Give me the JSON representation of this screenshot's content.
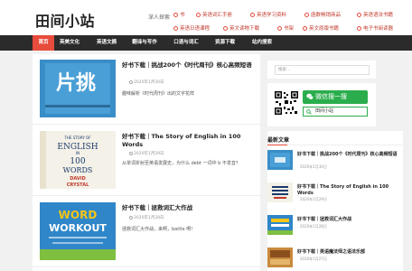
{
  "site": {
    "logo": "田间小站",
    "deep_explore": "深人探索"
  },
  "quicklinks": [
    {
      "label": "书"
    },
    {
      "label": "英语词汇手册"
    },
    {
      "label": "英语学习资料"
    },
    {
      "label": "函数畅销商品"
    },
    {
      "label": "英语语法书籍"
    },
    {
      "label": "英语日语课程"
    },
    {
      "label": "英文读物下载"
    },
    {
      "label": "书架"
    },
    {
      "label": "英文原版书籍"
    },
    {
      "label": "电子书阅读器"
    }
  ],
  "nav": {
    "items": [
      {
        "label": "首页",
        "active": true
      },
      {
        "label": "英美文化"
      },
      {
        "label": "英语文摘"
      },
      {
        "label": "翻译与写作"
      },
      {
        "label": "口语与词汇"
      },
      {
        "label": "资源下载"
      },
      {
        "label": "站内搜索"
      }
    ]
  },
  "articles": [
    {
      "title": "好书下载｜挑战200个《时代周刊》核心高频短语",
      "date": "2020年1月30日",
      "excerpt": "趣味解析《时代周刊》出的文字花样"
    },
    {
      "title": "好书下载｜The Story of English in 100 Words",
      "date": "2020年1月29日",
      "excerpt": "从单词折射至英语发展史，为什么 debt 一词中 b 不发音？"
    },
    {
      "title": "好书下载｜拯救词汇大作战",
      "date": "2020年1月28日",
      "excerpt": "拯救词汇大作战，来啊，battle 啊！"
    }
  ],
  "sidebar": {
    "search_placeholder": "搜索...",
    "wechat_button": "微信搜一搜",
    "wechat_query": "田间小站",
    "latest_heading": "最新文章",
    "latest": [
      {
        "title": "好书下载｜挑战200个《时代周刊》核心高频短语",
        "date": "2020年1月30日"
      },
      {
        "title": "好书下载｜The Story of English in 100 Words",
        "date": "2020年1月29日"
      },
      {
        "title": "好书下载｜拯救词汇大作战",
        "date": "2020年1月28日"
      },
      {
        "title": "好书下载｜英语魔法师之语法乐部",
        "date": "2020年1月27日"
      }
    ]
  },
  "thumb_text": {
    "book1_title": "片挑",
    "book2_lines": [
      "THE STORY OF",
      "ENGLISH",
      "IN",
      "100",
      "WORDS",
      "DAVID",
      "CRYSTAL"
    ],
    "book3_lines": [
      "WORD",
      "WORKOUT"
    ]
  },
  "colors": {
    "accent": "#e74c3c",
    "nav_bg": "#2b2b2b",
    "wechat_green": "#2bad4d"
  }
}
